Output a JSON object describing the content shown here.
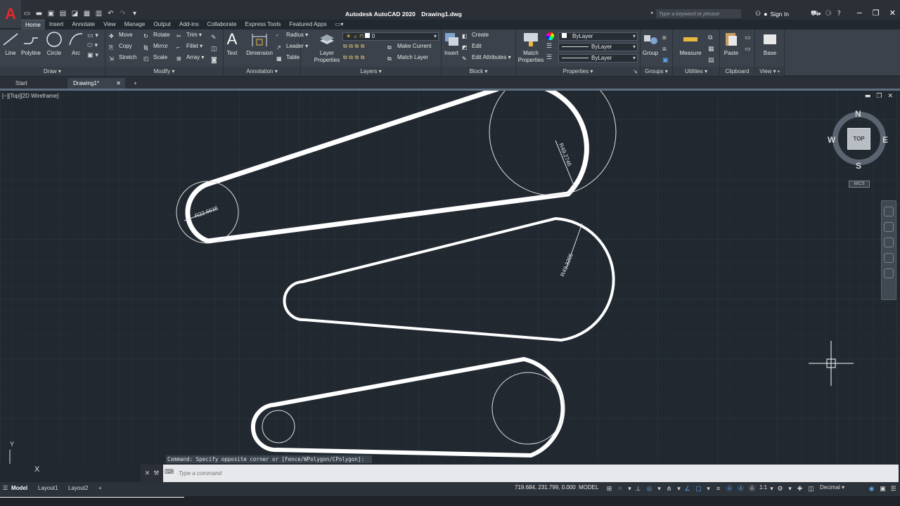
{
  "app": {
    "logo_letter": "A",
    "title": "Autodesk AutoCAD 2020",
    "filename": "Drawing1.dwg",
    "search_placeholder": "Type a keyword or phrase",
    "sign_in": "Sign In"
  },
  "ribbon_tabs": [
    "Home",
    "Insert",
    "Annotate",
    "View",
    "Manage",
    "Output",
    "Add-ins",
    "Collaborate",
    "Express Tools",
    "Featured Apps"
  ],
  "panels": {
    "draw": {
      "title": "Draw",
      "tools": [
        "Line",
        "Polyline",
        "Circle",
        "Arc"
      ]
    },
    "modify": {
      "title": "Modify",
      "tools": [
        "Move",
        "Rotate",
        "Trim",
        "Copy",
        "Mirror",
        "Fillet",
        "Stretch",
        "Scale",
        "Array"
      ]
    },
    "annotation": {
      "title": "Annotation",
      "big": [
        "Text",
        "Dimension"
      ],
      "small": [
        "Radius",
        "Leader",
        "Table"
      ]
    },
    "layers": {
      "title": "Layers",
      "big": "Layer Properties",
      "layer_value": "0",
      "small": [
        "Make Current",
        "Match Layer"
      ]
    },
    "block": {
      "title": "Block",
      "big": "Insert",
      "small": [
        "Create",
        "Edit",
        "Edit Attributes"
      ]
    },
    "properties": {
      "title": "Properties",
      "big": "Match Properties",
      "color": "ByLayer",
      "linetype": "ByLayer",
      "lineweight": "ByLayer"
    },
    "groups": {
      "title": "Groups",
      "big": "Group"
    },
    "utilities": {
      "title": "Utilities",
      "big": "Measure"
    },
    "clipboard": {
      "title": "Clipboard",
      "big": "Paste"
    },
    "view": {
      "title": "View",
      "big": "Base"
    }
  },
  "file_tabs": {
    "start": "Start",
    "drawing": "Drawing1*"
  },
  "viewport_label": "[−][Top][2D Wireframe]",
  "viewcube": {
    "n": "N",
    "s": "S",
    "e": "E",
    "w": "W",
    "face": "TOP",
    "wcs": "WCS"
  },
  "dimensions": {
    "r1": "R22.6615",
    "r2": "R49.2746",
    "r3": "R49.3205"
  },
  "ucs": {
    "x": "X",
    "y": "Y"
  },
  "command": {
    "history": "Command: Specify opposite corner or [Fence/WPolygon/CPolygon]:",
    "placeholder": "Type a command",
    "prompt_glyph": "⌨"
  },
  "status": {
    "layouts": [
      "Model",
      "Layout1",
      "Layout2"
    ],
    "coords": "719.684, 231.799, 0.000",
    "model": "MODEL",
    "scale": "1:1",
    "units": "Decimal"
  },
  "colors": {
    "accent": "#58a8f0",
    "logo_red": "#e8262c",
    "canvas": "#212830"
  }
}
